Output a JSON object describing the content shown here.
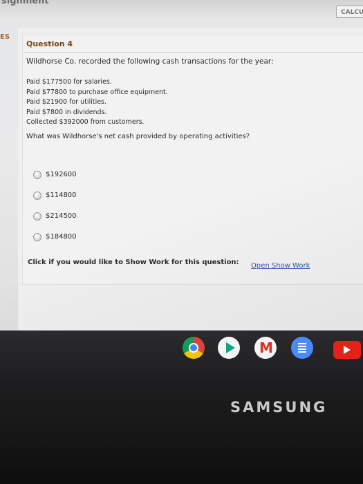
{
  "topbar": {
    "title": "signment",
    "calc_button_label": "CALCU"
  },
  "sidebar": {
    "label": "ES"
  },
  "question": {
    "title": "Question 4",
    "intro": "Wildhorse Co. recorded the following cash transactions for the year:",
    "transactions": [
      "Paid $177500 for salaries.",
      "Paid $77800 to purchase office equipment.",
      "Paid $21900 for utilities.",
      "Paid $7800 in dividends.",
      "Collected $392000 from customers."
    ],
    "prompt": "What was Wildhorse's net cash provided by operating activities?",
    "options": [
      "$192600",
      "$114800",
      "$214500",
      "$184800"
    ],
    "show_work_text": "Click if you would like to Show Work for this question:",
    "show_work_link": "Open Show Work"
  },
  "shelf": {
    "apps": [
      "chrome-icon",
      "play-store-icon",
      "gmail-icon",
      "google-docs-icon",
      "youtube-icon"
    ]
  },
  "device": {
    "brand": "SAMSUNG"
  }
}
